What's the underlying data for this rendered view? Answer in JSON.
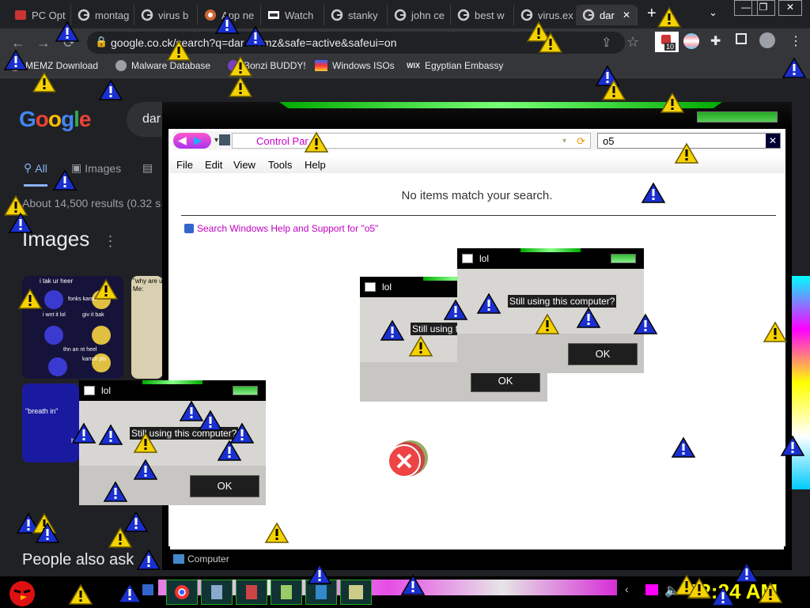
{
  "tabs": [
    {
      "title": "PC Opt",
      "favicon": "pc-optimizer-favicon",
      "active": false
    },
    {
      "title": "montag",
      "favicon": "google-favicon",
      "active": false
    },
    {
      "title": "virus b",
      "favicon": "google-favicon",
      "active": false
    },
    {
      "title": "App ne",
      "favicon": "app-favicon",
      "active": false
    },
    {
      "title": "Watch",
      "favicon": "watch-favicon",
      "active": false
    },
    {
      "title": "stanky",
      "favicon": "google-favicon",
      "active": false
    },
    {
      "title": "john ce",
      "favicon": "google-favicon",
      "active": false
    },
    {
      "title": "best w",
      "favicon": "google-favicon",
      "active": false
    },
    {
      "title": "virus.ex",
      "favicon": "google-favicon",
      "active": false
    },
    {
      "title": "dar",
      "favicon": "google-favicon",
      "active": true
    }
  ],
  "new_tab_label": "+",
  "url": "google.co.ck/search?q=dar  memz&safe=active&safeui=on",
  "extension_badge": "10",
  "bookmarks": [
    {
      "label": "MEMZ Download"
    },
    {
      "label": "Malware Database"
    },
    {
      "label": "Bonzi BUDDY!"
    },
    {
      "label": "Windows ISOs"
    },
    {
      "label": "Egyptian Embassy",
      "prefix": "WIX"
    }
  ],
  "google": {
    "logo": "Google",
    "query": "dar",
    "tabs": [
      {
        "label": "All"
      },
      {
        "label": "Images"
      }
    ],
    "results_text": "About 14,500 results (0.32 s",
    "images_heading": "Images",
    "thumb_texts": [
      "i tak ur heer",
      "fonks kamur",
      "i wnt it lol",
      "giv it bak",
      "thn an nt heel",
      "kamur pls",
      "\"why are u",
      "Me:",
      "\"breath in\"",
      "be"
    ],
    "people_also_ask": "People also ask"
  },
  "explorer": {
    "address": "Control Par",
    "search_value": "o5",
    "menu": [
      "File",
      "Edit",
      "View",
      "Tools",
      "Help"
    ],
    "no_items": "No items match your search.",
    "help_link": "Search Windows Help and Support for \"o5\"",
    "status": "Computer"
  },
  "dialogs": [
    {
      "title": "lol",
      "message": "Still using this computer?",
      "ok": "OK"
    },
    {
      "title": "lol",
      "message": "Still using this computer?",
      "ok": "OK"
    },
    {
      "title": "lol",
      "message": "Still using this computer?",
      "ok": "OK"
    }
  ],
  "taskbar": {
    "clock": "12:24 AM"
  },
  "colors": {
    "chrome_dark": "#202124",
    "chrome_toolbar": "#35363a",
    "link_magenta": "#c000c0",
    "warning_yellow": "#f5d200",
    "error_blue": "#1a2fd0",
    "clock_yellow": "#ffff00"
  }
}
